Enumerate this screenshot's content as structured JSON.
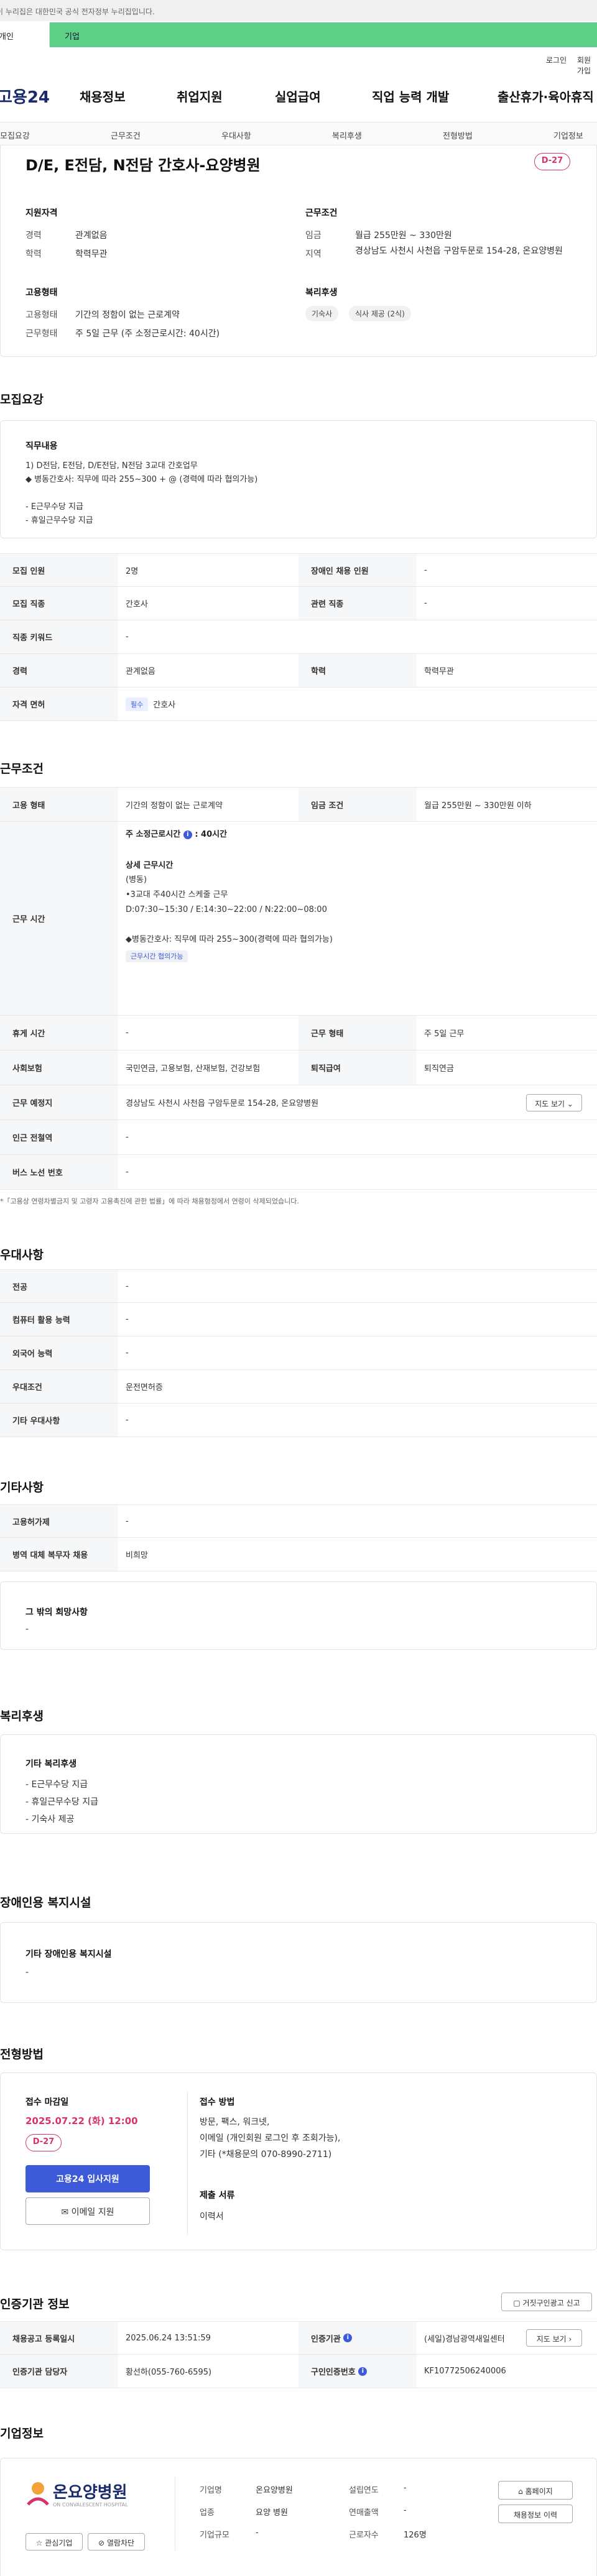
{
  "topbar": {
    "notice": "이 누리집은 대한민국 공식 전자정부 누리집입니다."
  },
  "tabs": {
    "personal": "개인",
    "company": "기업"
  },
  "util": {
    "login": "로그인",
    "join": "회원가입"
  },
  "gnb": {
    "logo": "고용24",
    "items": [
      "채용정보",
      "취업지원",
      "실업급여",
      "직업 능력 개발",
      "출산휴가·육아휴직"
    ]
  },
  "lnb": {
    "items": [
      "모집요강",
      "근무조건",
      "우대사항",
      "복리후생",
      "전형방법",
      "기업정보"
    ]
  },
  "summary": {
    "title": "D/E, E전담, N전담 간호사-요양병원",
    "dday": "D-27",
    "qual_title": "지원자격",
    "career_label": "경력",
    "career_value": "관계없음",
    "edu_label": "학력",
    "edu_value": "학력무관",
    "cond_title": "근무조건",
    "wage_label": "임금",
    "wage_value": "월급 255만원 ~ 330만원",
    "region_label": "지역",
    "region_value": "경상남도 사천시 사천읍 구암두문로 154-28, 온요양병원",
    "emp_title": "고용형태",
    "emptype_label": "고용형태",
    "emptype_value": "기간의 정함이 없는 근로계약",
    "worktype_label": "근무형태",
    "worktype_value": "주 5일 근무 (주 소정근로시간: 40시간)",
    "welfare_title": "복리후생",
    "welfare_tags": [
      "기숙사",
      "식사 제공 (2식)"
    ]
  },
  "recruit": {
    "section_title": "모집요강",
    "job_title": "직무내용",
    "job_lines": [
      "1) D전담, E전담,  D/E전담, N전담 3교대 간호업무",
      "◆ 병동간호사: 직무에 따라 255~300 + @ (경력에 따라 협의가능)",
      "",
      "- E근무수당 지급",
      "- 휴일근무수당 지급"
    ],
    "rows": [
      {
        "l1": "모집 인원",
        "v1": "2명",
        "l2": "장애인 채용 인원",
        "v2": "-"
      },
      {
        "l1": "모집 직종",
        "v1": "간호사",
        "l2": "관련 직종",
        "v2": "-"
      },
      {
        "l1": "직종 키워드",
        "v1": "-"
      },
      {
        "l1": "경력",
        "v1": "관계없음",
        "l2": "학력",
        "v2": "학력무관"
      }
    ],
    "license_label": "자격 면허",
    "license_badge": "필수",
    "license_value": "간호사"
  },
  "work": {
    "section_title": "근무조건",
    "emptype_label": "고용 형태",
    "emptype_value": "기간의 정함이 없는 근로계약",
    "wage_label": "임금 조건",
    "wage_value": "월급 255만원 ~ 330만원 이하",
    "hours_label": "근무 시간",
    "hours_main_a": "주 소정근로시간",
    "hours_main_b": ": 40시간",
    "detail_title": "상세 근무시간",
    "detail_lines": [
      "(병동)",
      "•3교대 주40시간 스케줄 근무",
      "D:07:30~15:30 / E:14:30~22:00 / N:22:00~08:00",
      "",
      "◆병동간호사: 직무에 따라 255~300(경력에 따라 협의가능)"
    ],
    "hours_tag": "근무시간 협의가능",
    "rows": [
      {
        "l1": "휴게 시간",
        "v1": "-",
        "l2": "근무 형태",
        "v2": "주 5일 근무"
      },
      {
        "l1": "사회보험",
        "v1": "국민연금, 고용보험, 산재보험, 건강보험",
        "l2": "퇴직급여",
        "v2": "퇴직연금"
      }
    ],
    "place_label": "근무 예정지",
    "place_value": "경상남도 사천시 사천읍 구암두문로 154-28, 온요양병원",
    "map_button": "지도 보기",
    "station_label": "인근 전철역",
    "station_value": "-",
    "bus_label": "버스 노선 번호",
    "bus_value": "-",
    "note": "*「고용상 연령차별금지 및 고령자 고용촉진에 관한 법률」에 따라 채용형정에서 연령이 삭제되었습니다."
  },
  "prefer": {
    "section_title": "우대사항",
    "rows": [
      {
        "l": "전공",
        "v": "-"
      },
      {
        "l": "컴퓨터 활용 능력",
        "v": "-"
      },
      {
        "l": "외국어 능력",
        "v": "-"
      },
      {
        "l": "우대조건",
        "v": "운전면허증"
      },
      {
        "l": "기타 우대사항",
        "v": "-"
      }
    ]
  },
  "etc": {
    "section_title": "기타사항",
    "rows": [
      {
        "l": "고용허가제",
        "v": "-"
      },
      {
        "l": "병역 대체 복무자 채용",
        "v": "비희망"
      }
    ],
    "hope_title": "그 밖의 희망사항",
    "hope_value": "-"
  },
  "benefit": {
    "section_title": "복리후생",
    "box_title": "기타 복리후생",
    "lines": [
      "- E근무수당 지급",
      "- 휴일근무수당 지급",
      "- 기숙사 제공"
    ]
  },
  "disabled": {
    "section_title": "장애인용 복지시설",
    "box_title": "기타 장애인용 복지시설",
    "value": "-"
  },
  "selection": {
    "section_title": "전형방법",
    "deadline_title": "접수 마감일",
    "deadline_value": "2025.07.22 (화) 12:00",
    "dday": "D-27",
    "apply_button": "고용24 입사지원",
    "email_button": "이메일 지원",
    "method_title": "접수 방법",
    "method_lines": [
      "방문, 팩스, 워크넷,",
      "이메일 (개인회원 로그인 후 조회가능),",
      "기타 (*채용문의 070-8990-2711)"
    ],
    "docs_title": "제출 서류",
    "docs_value": "이력서"
  },
  "cert": {
    "section_title": "인증기관 정보",
    "report_button": "거짓구인광고 신고",
    "rows": [
      {
        "l1": "채용공고 등록일시",
        "v1": "2025.06.24 13:51:59",
        "l2": "인증기관",
        "v2": "(세일)경남광역새일센터"
      },
      {
        "l1": "인증기관 담당자",
        "v1": "황선하(055-760-6595)",
        "l2": "구인인증번호",
        "v2": "KF10772506240006"
      }
    ],
    "map_button": "지도 보기"
  },
  "company": {
    "section_title": "기업정보",
    "logo_text": "온요양병원",
    "logo_sub": "ON CONVALESCENT HOSPITAL",
    "interest_button": "관심기업",
    "block_button": "열람차단",
    "fields": [
      {
        "l": "기업명",
        "v": "온요양병원"
      },
      {
        "l": "업종",
        "v": "요양 병원"
      },
      {
        "l": "기업규모",
        "v": "-"
      }
    ],
    "fields2": [
      {
        "l": "설립연도",
        "v": "-"
      },
      {
        "l": "연매출액",
        "v": "-"
      },
      {
        "l": "근로자수",
        "v": "126명"
      }
    ],
    "homepage_button": "홈페이지",
    "history_button": "채용정보 이력"
  },
  "colors": {
    "accent": "#3d5ad8",
    "dday": "#d6336c",
    "green": "#5ecf87"
  }
}
